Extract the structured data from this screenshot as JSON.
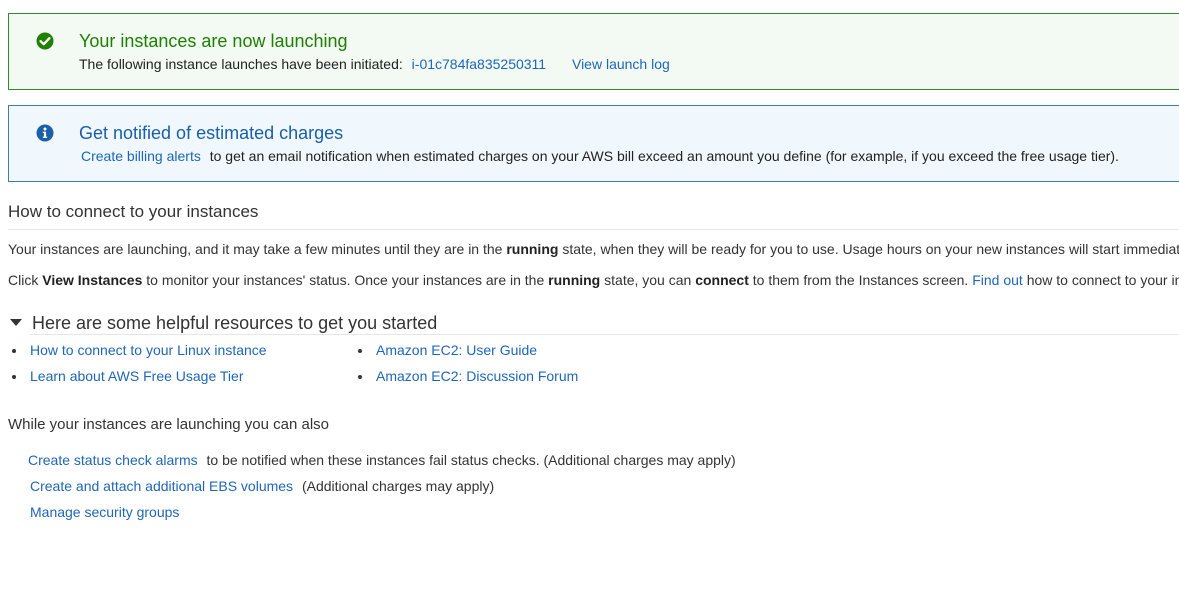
{
  "success_alert": {
    "title": "Your instances are now launching",
    "body_text": "The following instance launches have been initiated:",
    "instance_id": "i-01c784fa835250311",
    "view_launch_log": "View launch log",
    "color": "#1d8102",
    "icon": "check-circle-icon"
  },
  "info_alert": {
    "title": "Get notified of estimated charges",
    "link": "Create billing alerts",
    "body_text": "to get an email notification when estimated charges on your AWS bill exceed an amount you define (for example, if you exceed the free usage tier).",
    "color": "#1a5fa8",
    "icon": "info-circle-icon"
  },
  "connect_section": {
    "title": "How to connect to your instances",
    "para1": {
      "part1": "Your instances are launching, and it may take a few minutes until they are in the ",
      "bold1": "running",
      "part2": " state, when they will be ready for you to use. Usage hours on your new instances will start immediate"
    },
    "para2": {
      "part1": "Click ",
      "bold1": "View Instances",
      "part2": " to monitor your instances' status. Once your instances are in the ",
      "bold2": "running",
      "part3": " state, you can ",
      "bold3": "connect",
      "part4": " to them from the Instances screen. ",
      "link": "Find out",
      "part5": " how to connect to your ins"
    }
  },
  "resources": {
    "title": "Here are some helpful resources to get you started",
    "left_links": [
      "How to connect to your Linux instance",
      "Learn about AWS Free Usage Tier"
    ],
    "right_links": [
      "Amazon EC2: User Guide",
      "Amazon EC2: Discussion Forum"
    ]
  },
  "also": {
    "title": "While your instances are launching you can also",
    "items": [
      {
        "link": "Create status check alarms",
        "text": "to be notified when these instances fail status checks. (Additional charges may apply)"
      },
      {
        "link": "Create and attach additional EBS volumes",
        "text": "(Additional charges may apply)"
      },
      {
        "link": "Manage security groups",
        "text": ""
      }
    ]
  }
}
